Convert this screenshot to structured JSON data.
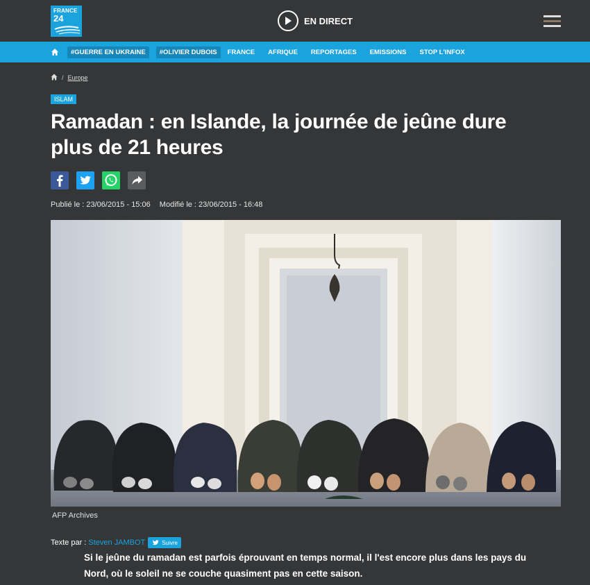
{
  "header": {
    "logo_line1": "FRANCE",
    "logo_line2": "24",
    "live_label": "EN DIRECT"
  },
  "nav": {
    "items": [
      {
        "label": "#GUERRE EN UKRAINE"
      },
      {
        "label": "#OLIVIER DUBOIS"
      },
      {
        "label": "FRANCE"
      },
      {
        "label": "AFRIQUE"
      },
      {
        "label": "REPORTAGES"
      },
      {
        "label": "EMISSIONS"
      },
      {
        "label": "STOP L'INFOX"
      }
    ]
  },
  "breadcrumb": {
    "sep": "/",
    "section": "Europe"
  },
  "article": {
    "tag": "ISLAM",
    "title": "Ramadan : en Islande, la journée de jeûne dure plus de 21 heures",
    "published": "Publié le : 23/06/2015 - 15:06",
    "modified": "Modifié le : 23/06/2015 - 16:48",
    "image_caption": "AFP Archives",
    "author_prefix": "Texte par :",
    "author_name": "Steven JAMBOT",
    "follow_label": "Suivre",
    "lead": "Si le jeûne du ramadan est parfois éprouvant en temps normal, il l'est encore plus dans les pays du Nord, où le soleil ne se couche quasiment pas en cette saison."
  },
  "icons": {
    "home": "home-icon",
    "play": "play-icon",
    "menu": "hamburger-icon",
    "facebook": "facebook-icon",
    "twitter": "twitter-icon",
    "whatsapp": "whatsapp-icon",
    "share": "share-icon"
  },
  "colors": {
    "background": "#343638",
    "accent": "#1aa3dc",
    "facebook": "#3b5998",
    "twitter": "#1da1f2",
    "whatsapp": "#25d366",
    "share": "#5a5c5e"
  }
}
